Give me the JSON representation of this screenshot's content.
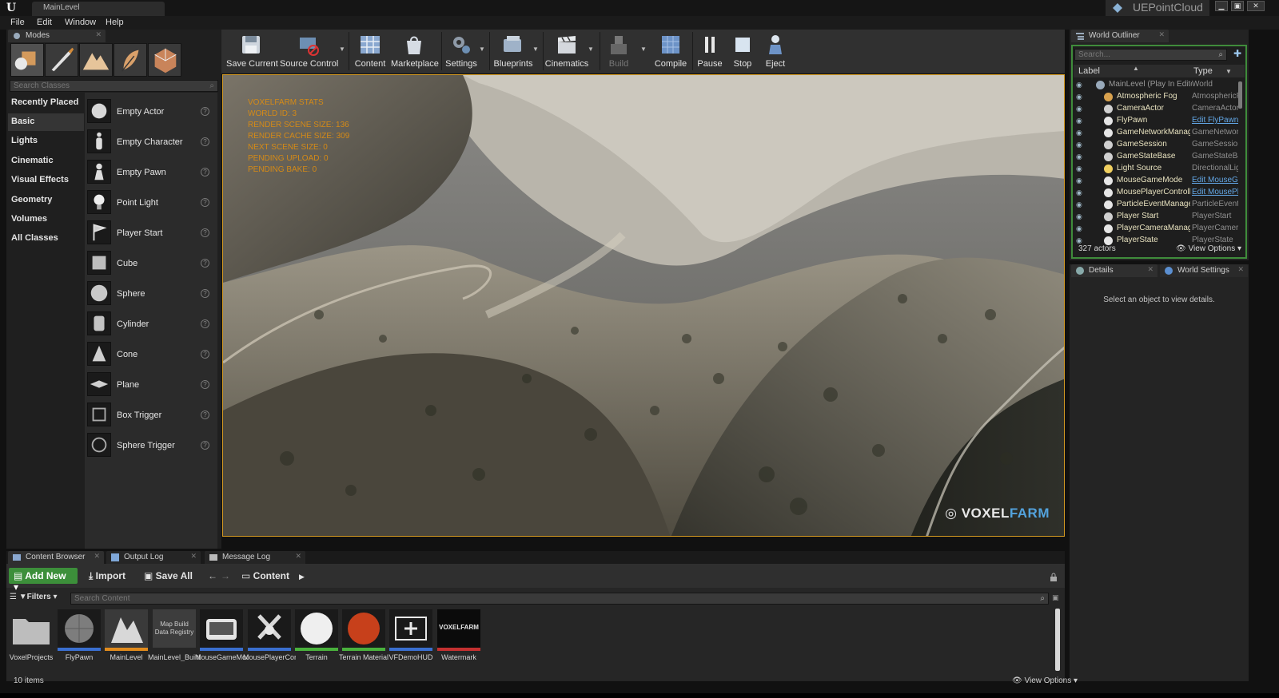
{
  "window": {
    "level_tab": "MainLevel",
    "project_name": "UEPointCloud"
  },
  "menu": [
    "File",
    "Edit",
    "Window",
    "Help"
  ],
  "modes": {
    "tab_label": "Modes",
    "search_placeholder": "Search Classes",
    "categories": [
      "Recently Placed",
      "Basic",
      "Lights",
      "Cinematic",
      "Visual Effects",
      "Geometry",
      "Volumes",
      "All Classes"
    ],
    "active_category": "Basic",
    "classes": [
      "Empty Actor",
      "Empty Character",
      "Empty Pawn",
      "Point Light",
      "Player Start",
      "Cube",
      "Sphere",
      "Cylinder",
      "Cone",
      "Plane",
      "Box Trigger",
      "Sphere Trigger"
    ]
  },
  "toolbar": {
    "save_current": "Save Current",
    "source_control": "Source Control",
    "content": "Content",
    "marketplace": "Marketplace",
    "settings": "Settings",
    "blueprints": "Blueprints",
    "cinematics": "Cinematics",
    "build": "Build",
    "compile": "Compile",
    "pause": "Pause",
    "stop": "Stop",
    "eject": "Eject"
  },
  "viewport": {
    "stats": [
      "VOXELFARM STATS",
      "WORLD ID: 3",
      "RENDER SCENE SIZE: 136",
      "RENDER CACHE SIZE: 309",
      "NEXT SCENE SIZE: 0",
      "PENDING UPLOAD: 0",
      "PENDING BAKE: 0"
    ],
    "logo_voxel": "VOXEL",
    "logo_farm": "FARM"
  },
  "outliner": {
    "tab_label": "World Outliner",
    "search_placeholder": "Search...",
    "col_label": "Label",
    "col_type": "Type",
    "rows": [
      {
        "label": "MainLevel (Play In Editor)",
        "type": "World",
        "link": false,
        "root": true
      },
      {
        "label": "Atmospheric Fog",
        "type": "AtmosphericFog",
        "link": false
      },
      {
        "label": "CameraActor",
        "type": "CameraActor",
        "link": false
      },
      {
        "label": "FlyPawn",
        "type": "Edit FlyPawn",
        "link": true
      },
      {
        "label": "GameNetworkManager",
        "type": "GameNetworkManager",
        "link": false
      },
      {
        "label": "GameSession",
        "type": "GameSession",
        "link": false
      },
      {
        "label": "GameStateBase",
        "type": "GameStateBase",
        "link": false
      },
      {
        "label": "Light Source",
        "type": "DirectionalLight",
        "link": false
      },
      {
        "label": "MouseGameMode",
        "type": "Edit MouseGameMode",
        "link": true
      },
      {
        "label": "MousePlayerController",
        "type": "Edit MousePlayerController",
        "link": true
      },
      {
        "label": "ParticleEventManager",
        "type": "ParticleEventManager",
        "link": false
      },
      {
        "label": "Player Start",
        "type": "PlayerStart",
        "link": false
      },
      {
        "label": "PlayerCameraManager",
        "type": "PlayerCameraManager",
        "link": false
      },
      {
        "label": "PlayerState",
        "type": "PlayerState",
        "link": false
      }
    ],
    "actor_count": "327 actors",
    "view_options": "View Options"
  },
  "details": {
    "tab_label": "Details",
    "world_settings_tab": "World Settings",
    "empty_message": "Select an object to view details."
  },
  "bottom_tabs": [
    "Content Browser",
    "Output Log",
    "Message Log"
  ],
  "content_browser": {
    "add_new": "Add New",
    "import": "Import",
    "save_all": "Save All",
    "path": "Content",
    "filters": "Filters",
    "search_placeholder": "Search Content",
    "assets": [
      {
        "name": "VoxelProjects",
        "color": "#262626"
      },
      {
        "name": "FlyPawn",
        "color": "#3a6fd0"
      },
      {
        "name": "MainLevel",
        "color": "#e18b1d"
      },
      {
        "name": "MainLevel_BuiltData",
        "color": "#262626"
      },
      {
        "name": "MouseGameMode",
        "color": "#3a6fd0"
      },
      {
        "name": "MousePlayerController",
        "color": "#3a6fd0"
      },
      {
        "name": "Terrain",
        "color": "#49b13c"
      },
      {
        "name": "Terrain Material",
        "color": "#49b13c"
      },
      {
        "name": "VFDemoHUD",
        "color": "#3a6fd0"
      },
      {
        "name": "Watermark",
        "color": "#c43030"
      }
    ],
    "map_build_thumb": "Map Build Data Registry",
    "watermark_thumb": "VOXELFARM",
    "item_count": "10 items",
    "view_options": "View Options"
  }
}
